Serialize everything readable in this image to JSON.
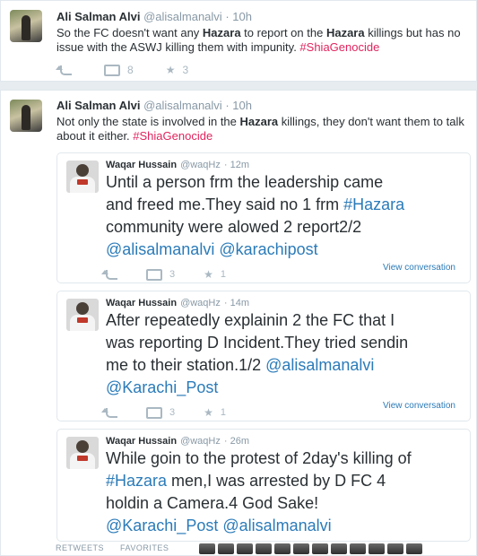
{
  "tweet1": {
    "name": "Ali Salman Alvi",
    "handle": "@alisalmanalvi",
    "time": "· 10h",
    "line1_a": "So the FC doesn't want any ",
    "line1_b": "Hazara",
    "line1_c": " to report on the ",
    "line1_d": "Hazara",
    "line1_e": " killings but has no",
    "line2_a": "issue with the ASWJ killing them with impunity. ",
    "line2_tag": "#ShiaGenocide",
    "retweets": "8",
    "favorites": "3"
  },
  "tweet2": {
    "name": "Ali Salman Alvi",
    "handle": "@alisalmanalvi",
    "time": "· 10h",
    "line1_a": "Not only the state is involved in the ",
    "line1_b": "Hazara",
    "line1_c": " killings, they don't want them to talk",
    "line2_a": "about it either. ",
    "line2_tag": "#ShiaGenocide"
  },
  "embeds": [
    {
      "name": "Waqar Hussain",
      "handle": "@waqHz",
      "time": "· 12m",
      "line1": "Until a person frm the leadership came",
      "line2": "and freed me.They said no 1 frm ",
      "line2_tag": "#Hazara",
      "line3": "community were alowed 2 report2/2",
      "line4_m1": "@alisalmanalvi",
      "line4_m2": "@karachipost",
      "retweets": "3",
      "favorites": "1",
      "view": "View conversation"
    },
    {
      "name": "Waqar Hussain",
      "handle": "@waqHz",
      "time": "· 14m",
      "line1": "After repeatedly explainin 2 the FC that I",
      "line2": "was reporting D Incident.They tried sendin",
      "line3_a": "me to their station.1/2 ",
      "line3_m": "@alisalmanalvi",
      "line4_m": "@Karachi_Post",
      "retweets": "3",
      "favorites": "1",
      "view": "View conversation"
    },
    {
      "name": "Waqar Hussain",
      "handle": "@waqHz",
      "time": "· 26m",
      "line1": "While goin to the protest of 2day's killing of",
      "line2_tag": "#Hazara",
      "line2": " men,I was arrested by D FC 4",
      "line3": "holdin a Camera.4 God Sake!",
      "line4_m1": "@Karachi_Post",
      "line4_m2": "@alisalmanalvi"
    }
  ],
  "footer": {
    "retweets_label": "RETWEETS",
    "favorites_label": "FAVORITES"
  },
  "colors": {
    "link": "#2b7bb9",
    "hashtag": "#e0245e",
    "background": "#e6ecf0"
  },
  "icons": [
    "reply-icon",
    "retweet-icon",
    "favorite-icon"
  ]
}
